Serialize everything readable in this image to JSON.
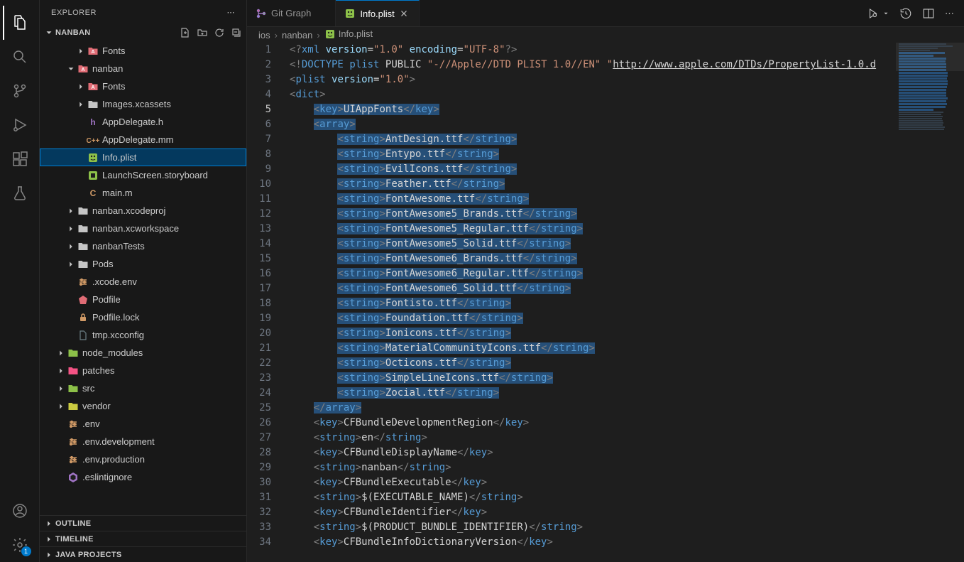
{
  "sidebar": {
    "title": "EXPLORER",
    "root": "NANBAN",
    "outline": "OUTLINE",
    "timeline": "TIMELINE",
    "java": "JAVA PROJECTS"
  },
  "tree": [
    {
      "depth": 3,
      "kind": "folder-red",
      "chev": "right",
      "label": "Fonts"
    },
    {
      "depth": 2,
      "kind": "folder-red",
      "chev": "down",
      "label": "nanban"
    },
    {
      "depth": 3,
      "kind": "folder-red",
      "chev": "right",
      "label": "Fonts"
    },
    {
      "depth": 3,
      "kind": "folder",
      "chev": "right",
      "label": "Images.xcassets"
    },
    {
      "depth": 3,
      "kind": "h",
      "chev": "",
      "label": "AppDelegate.h"
    },
    {
      "depth": 3,
      "kind": "cpp",
      "chev": "",
      "label": "AppDelegate.mm"
    },
    {
      "depth": 3,
      "kind": "plist",
      "chev": "",
      "label": "Info.plist",
      "selected": true
    },
    {
      "depth": 3,
      "kind": "storyboard",
      "chev": "",
      "label": "LaunchScreen.storyboard"
    },
    {
      "depth": 3,
      "kind": "c",
      "chev": "",
      "label": "main.m"
    },
    {
      "depth": 2,
      "kind": "folder",
      "chev": "right",
      "label": "nanban.xcodeproj"
    },
    {
      "depth": 2,
      "kind": "folder",
      "chev": "right",
      "label": "nanban.xcworkspace"
    },
    {
      "depth": 2,
      "kind": "folder",
      "chev": "right",
      "label": "nanbanTests"
    },
    {
      "depth": 2,
      "kind": "folder",
      "chev": "right",
      "label": "Pods"
    },
    {
      "depth": 2,
      "kind": "tune",
      "chev": "",
      "label": ".xcode.env"
    },
    {
      "depth": 2,
      "kind": "ruby",
      "chev": "",
      "label": "Podfile"
    },
    {
      "depth": 2,
      "kind": "lock",
      "chev": "",
      "label": "Podfile.lock"
    },
    {
      "depth": 2,
      "kind": "file",
      "chev": "",
      "label": "tmp.xcconfig"
    },
    {
      "depth": 1,
      "kind": "folder-green",
      "chev": "right",
      "label": "node_modules"
    },
    {
      "depth": 1,
      "kind": "folder-pink",
      "chev": "right",
      "label": "patches"
    },
    {
      "depth": 1,
      "kind": "folder-green",
      "chev": "right",
      "label": "src"
    },
    {
      "depth": 1,
      "kind": "folder-yellow",
      "chev": "right",
      "label": "vendor"
    },
    {
      "depth": 1,
      "kind": "tune",
      "chev": "",
      "label": ".env"
    },
    {
      "depth": 1,
      "kind": "tune",
      "chev": "",
      "label": ".env.development"
    },
    {
      "depth": 1,
      "kind": "tune",
      "chev": "",
      "label": ".env.production"
    },
    {
      "depth": 1,
      "kind": "eslint",
      "chev": "",
      "label": ".eslintignore"
    }
  ],
  "tabs": [
    {
      "icon": "gitgraph",
      "label": "Git Graph",
      "active": false
    },
    {
      "icon": "plist",
      "label": "Info.plist",
      "active": true
    }
  ],
  "breadcrumb": [
    "ios",
    "nanban",
    "Info.plist"
  ],
  "settings_badge": "1",
  "code_lines": [
    {
      "n": 1,
      "html": "<span class='pi'>&lt;?</span><span class='tag'>xml</span> <span class='attr'>version</span>=<span class='str'>\"1.0\"</span> <span class='attr'>encoding</span>=<span class='str'>\"UTF-8\"</span><span class='pi'>?&gt;</span>"
    },
    {
      "n": 2,
      "html": "<span class='pi'>&lt;!</span><span class='tag'>DOCTYPE</span> <span class='tag'>plist</span> <span class='txt'>PUBLIC </span><span class='str'>\"-//Apple//DTD PLIST 1.0//EN\"</span> <span class='str'>\"<span class='link'>http://www.apple.com/DTDs/PropertyList-1.0.d</span></span>"
    },
    {
      "n": 3,
      "html": "<span class='pi'>&lt;</span><span class='tag'>plist</span> <span class='attr'>version</span>=<span class='str'>\"1.0\"</span><span class='pi'>&gt;</span>"
    },
    {
      "n": 4,
      "html": "<span class='pi'>&lt;</span><span class='tag'>dict</span><span class='pi'>&gt;</span>"
    },
    {
      "n": 5,
      "current": true,
      "html": "    <span class='sel'><span class='pi'>&lt;</span><span class='tag'>key</span><span class='pi'>&gt;</span>UIAppFonts<span class='pi'>&lt;/</span><span class='tag'>key</span><span class='pi'>&gt;</span></span>"
    },
    {
      "n": 6,
      "html": "    <span class='sel'><span class='pi'>&lt;</span><span class='tag'>array</span><span class='pi'>&gt;</span></span>"
    },
    {
      "n": 7,
      "html": "        <span class='sel'><span class='pi'>&lt;</span><span class='tag'>string</span><span class='pi'>&gt;</span>AntDesign.ttf<span class='pi'>&lt;/</span><span class='tag'>string</span><span class='pi'>&gt;</span></span>"
    },
    {
      "n": 8,
      "html": "        <span class='sel'><span class='pi'>&lt;</span><span class='tag'>string</span><span class='pi'>&gt;</span>Entypo.ttf<span class='pi'>&lt;/</span><span class='tag'>string</span><span class='pi'>&gt;</span></span>"
    },
    {
      "n": 9,
      "html": "        <span class='sel'><span class='pi'>&lt;</span><span class='tag'>string</span><span class='pi'>&gt;</span>EvilIcons.ttf<span class='pi'>&lt;/</span><span class='tag'>string</span><span class='pi'>&gt;</span></span>"
    },
    {
      "n": 10,
      "html": "        <span class='sel'><span class='pi'>&lt;</span><span class='tag'>string</span><span class='pi'>&gt;</span>Feather.ttf<span class='pi'>&lt;/</span><span class='tag'>string</span><span class='pi'>&gt;</span></span>"
    },
    {
      "n": 11,
      "html": "        <span class='sel'><span class='pi'>&lt;</span><span class='tag'>string</span><span class='pi'>&gt;</span>FontAwesome.ttf<span class='pi'>&lt;/</span><span class='tag'>string</span><span class='pi'>&gt;</span></span>"
    },
    {
      "n": 12,
      "html": "        <span class='sel'><span class='pi'>&lt;</span><span class='tag'>string</span><span class='pi'>&gt;</span>FontAwesome5_Brands.ttf<span class='pi'>&lt;/</span><span class='tag'>string</span><span class='pi'>&gt;</span></span>"
    },
    {
      "n": 13,
      "html": "        <span class='sel'><span class='pi'>&lt;</span><span class='tag'>string</span><span class='pi'>&gt;</span>FontAwesome5_Regular.ttf<span class='pi'>&lt;/</span><span class='tag'>string</span><span class='pi'>&gt;</span></span>"
    },
    {
      "n": 14,
      "html": "        <span class='sel'><span class='pi'>&lt;</span><span class='tag'>string</span><span class='pi'>&gt;</span>FontAwesome5_Solid.ttf<span class='pi'>&lt;/</span><span class='tag'>string</span><span class='pi'>&gt;</span></span>"
    },
    {
      "n": 15,
      "html": "        <span class='sel'><span class='pi'>&lt;</span><span class='tag'>string</span><span class='pi'>&gt;</span>FontAwesome6_Brands.ttf<span class='pi'>&lt;/</span><span class='tag'>string</span><span class='pi'>&gt;</span></span>"
    },
    {
      "n": 16,
      "html": "        <span class='sel'><span class='pi'>&lt;</span><span class='tag'>string</span><span class='pi'>&gt;</span>FontAwesome6_Regular.ttf<span class='pi'>&lt;/</span><span class='tag'>string</span><span class='pi'>&gt;</span></span>"
    },
    {
      "n": 17,
      "html": "        <span class='sel'><span class='pi'>&lt;</span><span class='tag'>string</span><span class='pi'>&gt;</span>FontAwesome6_Solid.ttf<span class='pi'>&lt;/</span><span class='tag'>string</span><span class='pi'>&gt;</span></span>"
    },
    {
      "n": 18,
      "html": "        <span class='sel'><span class='pi'>&lt;</span><span class='tag'>string</span><span class='pi'>&gt;</span>Fontisto.ttf<span class='pi'>&lt;/</span><span class='tag'>string</span><span class='pi'>&gt;</span></span>"
    },
    {
      "n": 19,
      "html": "        <span class='sel'><span class='pi'>&lt;</span><span class='tag'>string</span><span class='pi'>&gt;</span>Foundation.ttf<span class='pi'>&lt;/</span><span class='tag'>string</span><span class='pi'>&gt;</span></span>"
    },
    {
      "n": 20,
      "html": "        <span class='sel'><span class='pi'>&lt;</span><span class='tag'>string</span><span class='pi'>&gt;</span>Ionicons.ttf<span class='pi'>&lt;/</span><span class='tag'>string</span><span class='pi'>&gt;</span></span>"
    },
    {
      "n": 21,
      "html": "        <span class='sel'><span class='pi'>&lt;</span><span class='tag'>string</span><span class='pi'>&gt;</span>MaterialCommunityIcons.ttf<span class='pi'>&lt;/</span><span class='tag'>string</span><span class='pi'>&gt;</span></span>"
    },
    {
      "n": 22,
      "html": "        <span class='sel'><span class='pi'>&lt;</span><span class='tag'>string</span><span class='pi'>&gt;</span>Octicons.ttf<span class='pi'>&lt;/</span><span class='tag'>string</span><span class='pi'>&gt;</span></span>"
    },
    {
      "n": 23,
      "html": "        <span class='sel'><span class='pi'>&lt;</span><span class='tag'>string</span><span class='pi'>&gt;</span>SimpleLineIcons.ttf<span class='pi'>&lt;/</span><span class='tag'>string</span><span class='pi'>&gt;</span></span>"
    },
    {
      "n": 24,
      "html": "        <span class='sel'><span class='pi'>&lt;</span><span class='tag'>string</span><span class='pi'>&gt;</span>Zocial.ttf<span class='pi'>&lt;/</span><span class='tag'>string</span><span class='pi'>&gt;</span></span>"
    },
    {
      "n": 25,
      "html": "    <span class='sel'><span class='pi'>&lt;/</span><span class='tag'>array</span><span class='pi'>&gt;</span></span>"
    },
    {
      "n": 26,
      "html": "    <span class='pi'>&lt;</span><span class='tag'>key</span><span class='pi'>&gt;</span>CFBundleDevelopmentRegion<span class='pi'>&lt;/</span><span class='tag'>key</span><span class='pi'>&gt;</span>"
    },
    {
      "n": 27,
      "html": "    <span class='pi'>&lt;</span><span class='tag'>string</span><span class='pi'>&gt;</span>en<span class='pi'>&lt;/</span><span class='tag'>string</span><span class='pi'>&gt;</span>"
    },
    {
      "n": 28,
      "html": "    <span class='pi'>&lt;</span><span class='tag'>key</span><span class='pi'>&gt;</span>CFBundleDisplayName<span class='pi'>&lt;/</span><span class='tag'>key</span><span class='pi'>&gt;</span>"
    },
    {
      "n": 29,
      "html": "    <span class='pi'>&lt;</span><span class='tag'>string</span><span class='pi'>&gt;</span>nanban<span class='pi'>&lt;/</span><span class='tag'>string</span><span class='pi'>&gt;</span>"
    },
    {
      "n": 30,
      "html": "    <span class='pi'>&lt;</span><span class='tag'>key</span><span class='pi'>&gt;</span>CFBundleExecutable<span class='pi'>&lt;/</span><span class='tag'>key</span><span class='pi'>&gt;</span>"
    },
    {
      "n": 31,
      "html": "    <span class='pi'>&lt;</span><span class='tag'>string</span><span class='pi'>&gt;</span>$(EXECUTABLE_NAME)<span class='pi'>&lt;/</span><span class='tag'>string</span><span class='pi'>&gt;</span>"
    },
    {
      "n": 32,
      "html": "    <span class='pi'>&lt;</span><span class='tag'>key</span><span class='pi'>&gt;</span>CFBundleIdentifier<span class='pi'>&lt;/</span><span class='tag'>key</span><span class='pi'>&gt;</span>"
    },
    {
      "n": 33,
      "html": "    <span class='pi'>&lt;</span><span class='tag'>string</span><span class='pi'>&gt;</span>$(PRODUCT_BUNDLE_IDENTIFIER)<span class='pi'>&lt;/</span><span class='tag'>string</span><span class='pi'>&gt;</span>"
    },
    {
      "n": 34,
      "html": "    <span class='pi'>&lt;</span><span class='tag'>key</span><span class='pi'>&gt;</span>CFBundleInfoDictionaryVersion<span class='pi'>&lt;/</span><span class='tag'>key</span><span class='pi'>&gt;</span>"
    }
  ]
}
